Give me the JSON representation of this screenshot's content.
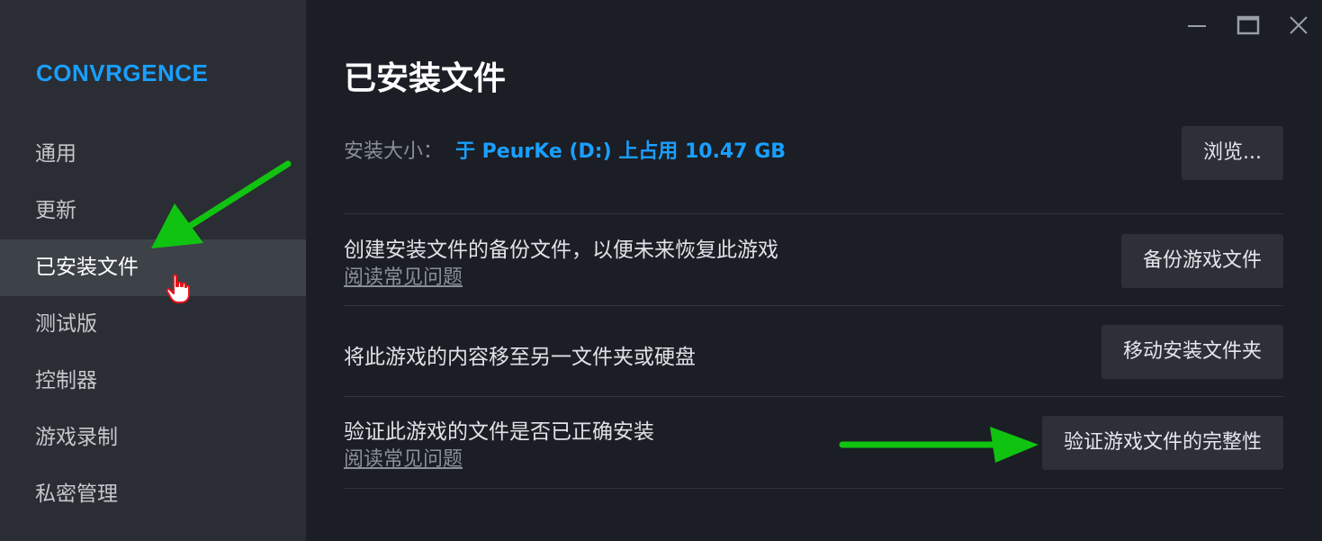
{
  "sidebar": {
    "brand": "CONVRGENCE",
    "items": [
      {
        "label": "通用"
      },
      {
        "label": "更新"
      },
      {
        "label": "已安装文件",
        "active": true
      },
      {
        "label": "测试版"
      },
      {
        "label": "控制器"
      },
      {
        "label": "游戏录制"
      },
      {
        "label": "私密管理"
      }
    ]
  },
  "window": {
    "controls": [
      "minimize-icon",
      "maximize-icon",
      "close-icon"
    ]
  },
  "main": {
    "title": "已安装文件",
    "install_size": {
      "label": "安装大小：",
      "value": "于 PeurKe (D:) 上占用 10.47 GB",
      "button": "浏览..."
    },
    "backup": {
      "title": "创建安装文件的备份文件，以便未来恢复此游戏",
      "link": "阅读常见问题",
      "button": "备份游戏文件"
    },
    "move": {
      "title": "将此游戏的内容移至另一文件夹或硬盘",
      "button": "移动安装文件夹"
    },
    "verify": {
      "title": "验证此游戏的文件是否已正确安装",
      "link": "阅读常见问题",
      "button": "验证游戏文件的完整性"
    }
  },
  "colors": {
    "accent": "#1a9fff",
    "annotation_arrow": "#11c311",
    "sidebar_bg": "#2a2d33",
    "main_bg": "#1b1e25",
    "active_item_bg": "#3d4249",
    "button_bg": "#2d3038"
  }
}
